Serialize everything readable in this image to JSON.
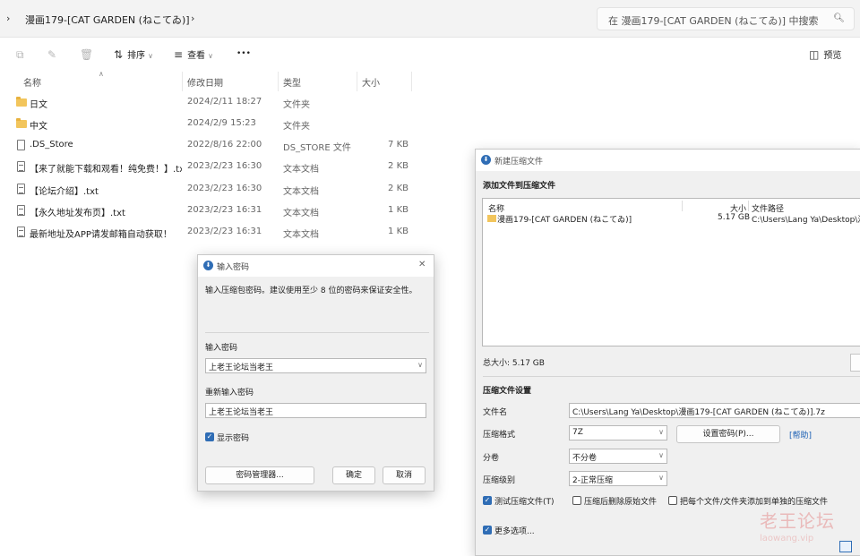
{
  "explorer": {
    "address": {
      "chevron_left": "›",
      "path": "漫画179-[CAT GARDEN (ねこてゐ)]",
      "chevron_right": "›"
    },
    "search": {
      "placeholder": "在 漫画179-[CAT GARDEN (ねこてゐ)] 中搜索",
      "icon": "search-icon"
    },
    "toolbar": {
      "sort_label": "排序",
      "view_label": "查看",
      "more_label": "•••",
      "preview_label": "预览"
    },
    "columns": {
      "name": "名称",
      "date": "修改日期",
      "type": "类型",
      "size": "大小"
    },
    "files": [
      {
        "name": "日文",
        "date": "2024/2/11 18:27",
        "type": "文件夹",
        "size": "",
        "icon": "folder-icon"
      },
      {
        "name": "中文",
        "date": "2024/2/9 15:23",
        "type": "文件夹",
        "size": "",
        "icon": "folder-icon"
      },
      {
        "name": ".DS_Store",
        "date": "2022/8/16 22:00",
        "type": "DS_STORE 文件",
        "size": "7 KB",
        "icon": "file-icon"
      },
      {
        "name": "【来了就能下载和观看！纯免费！】.txt",
        "date": "2023/2/23 16:30",
        "type": "文本文档",
        "size": "2 KB",
        "icon": "text-file-icon"
      },
      {
        "name": "【论坛介绍】.txt",
        "date": "2023/2/23 16:30",
        "type": "文本文档",
        "size": "2 KB",
        "icon": "text-file-icon"
      },
      {
        "name": "【永久地址发布页】.txt",
        "date": "2023/2/23 16:31",
        "type": "文本文档",
        "size": "1 KB",
        "icon": "text-file-icon"
      },
      {
        "name": "最新地址及APP请发邮箱自动获取！",
        "date": "2023/2/23 16:31",
        "type": "文本文档",
        "size": "1 KB",
        "icon": "text-file-icon"
      }
    ]
  },
  "password_dialog": {
    "title": "输入密码",
    "description": "输入压缩包密码。建议使用至少 8 位的密码来保证安全性。",
    "label_password": "输入密码",
    "password_value": "上老王论坛当老王",
    "label_repeat": "重新输入密码",
    "repeat_value": "上老王论坛当老王",
    "show_password_label": "显示密码",
    "show_password_checked": true,
    "manager_button": "密码管理器...",
    "ok_button": "确定",
    "cancel_button": "取消"
  },
  "archive_dialog": {
    "title": "新建压缩文件",
    "section_add": "添加文件到压缩文件",
    "list_headers": {
      "name": "名称",
      "size": "大小",
      "path": "文件路径"
    },
    "list_item": {
      "name": "漫画179-[CAT GARDEN (ねこてゐ)]",
      "size": "5.17 GB",
      "path": "C:\\Users\\Lang Ya\\Desktop\\漫"
    },
    "total_size": "总大小: 5.17 GB",
    "section_settings": "压缩文件设置",
    "filename_label": "文件名",
    "filename_value": "C:\\Users\\Lang Ya\\Desktop\\漫画179-[CAT GARDEN (ねこてゐ)].7z",
    "format_label": "压缩格式",
    "format_value": "7Z",
    "set_password_button": "设置密码(P)...",
    "help_link": "[帮助]",
    "split_label": "分卷",
    "split_value": "不分卷",
    "level_label": "压缩级别",
    "level_value": "2-正常压缩",
    "test_label": "测试压缩文件(T)",
    "test_checked": true,
    "delete_label": "压缩后删除原始文件",
    "delete_checked": false,
    "separate_label": "把每个文件/文件夹添加到单独的压缩文件",
    "separate_checked": false,
    "more_label": "更多选项...",
    "more_checked": true
  },
  "watermark": {
    "main": "老王论坛",
    "sub": "laowang.vip"
  },
  "colors": {
    "accent": "#2f6db5",
    "folder": "#f2c55c",
    "link": "#1a5fb4"
  }
}
